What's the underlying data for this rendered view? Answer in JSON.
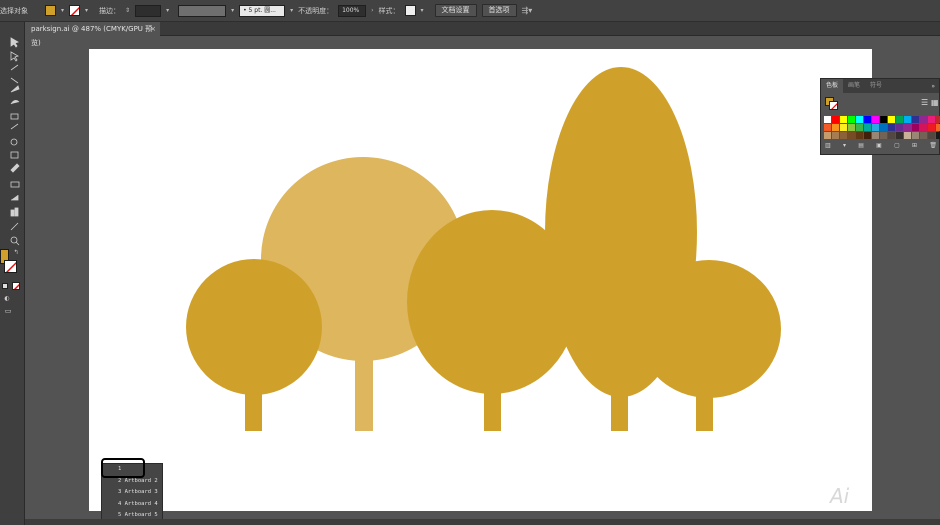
{
  "control_bar": {
    "selection_label": "选择对象",
    "stroke_label": "描边：",
    "brush_value": "• 5 pt. 圆...",
    "opacity_label": "不透明度：",
    "opacity_value": "100%",
    "style_label": "样式：",
    "doc_setup_label": "文档设置",
    "prefs_label": "首选项",
    "fill_color": "#d0a12a"
  },
  "document_tab": {
    "title": "parksign.ai @ 487% (CMYK/GPU 预览)",
    "close": "×"
  },
  "swatches_panel": {
    "tabs": [
      "色板",
      "画笔",
      "符号"
    ],
    "active_tab": "色板",
    "current_fill": "#d0a12a",
    "colors": [
      "#ffffff",
      "#ff0000",
      "#ffff00",
      "#00ff00",
      "#00ffff",
      "#0000ff",
      "#ff00ff",
      "#000000",
      "#ffff00",
      "#00a650",
      "#00aeef",
      "#2e3192",
      "#92278f",
      "#ed1e79",
      "#c1272d",
      "#f15a24",
      "#f7931e",
      "#fcee21",
      "#8cc63f",
      "#39b54a",
      "#00a99d",
      "#29abe2",
      "#0071bc",
      "#2e3192",
      "#662d91",
      "#93278f",
      "#9e005d",
      "#d4145a",
      "#ed1c24",
      "#f26522",
      "#c69c6d",
      "#a67c52",
      "#8c6239",
      "#754c24",
      "#603813",
      "#42210b",
      "#998675",
      "#736357",
      "#534741",
      "#362f2d",
      "#c7b299",
      "#998675",
      "#736357",
      "#534741",
      "#1a1a1a"
    ],
    "footer_icons": [
      "library-icon",
      "show-kind-icon",
      "swatch-options-icon",
      "color-group-icon",
      "new-group-icon",
      "new-swatch-icon",
      "delete-icon"
    ]
  },
  "artboard": {
    "trees": {
      "light": "#ddb65e",
      "dark": "#d0a12a"
    }
  },
  "artboard_menu": {
    "items": [
      "1",
      "2 Artboard 2",
      "3 Artboard 3",
      "4 Artboard 4",
      "5 Artboard 5"
    ],
    "selected": "1"
  },
  "watermark": "Ai"
}
